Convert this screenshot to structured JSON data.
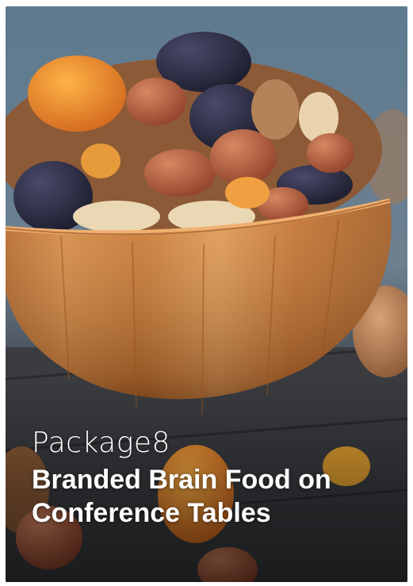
{
  "card": {
    "eyebrow": "Package8",
    "headline": "Branded Brain Food on Conference Tables",
    "image_subject": "wooden-bowl-of-mixed-nuts-and-dried-fruit"
  },
  "colors": {
    "text": "#ffffff",
    "bowl_wood": "#c97a33",
    "table_wood": "#3b3d41",
    "background_blue": "#6f8596"
  }
}
